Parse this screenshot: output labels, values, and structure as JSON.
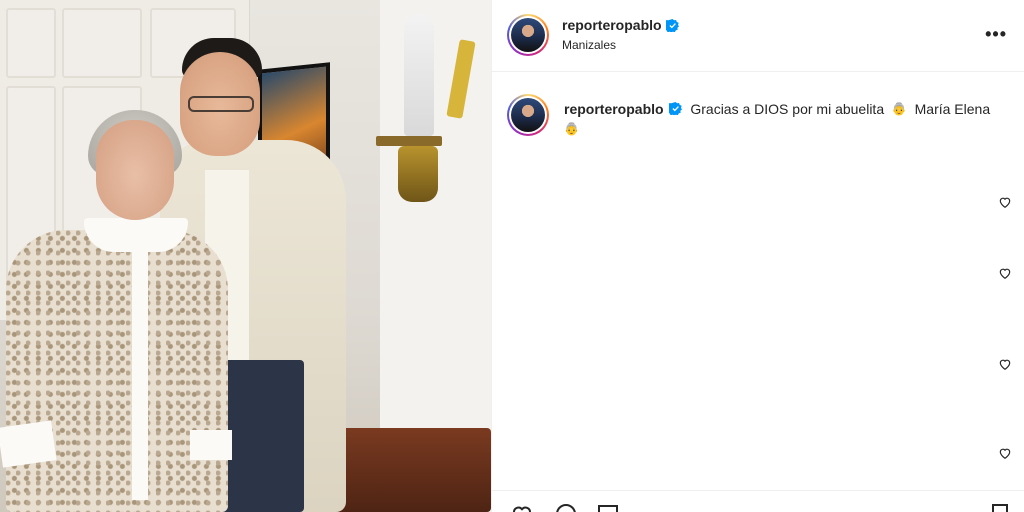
{
  "post": {
    "author": {
      "username": "reporteropablo",
      "location": "Manizales",
      "verified": true
    },
    "caption": {
      "username": "reporteropablo",
      "text_part1": "Gracias a DIOS por mi abuelita",
      "emoji1": "👵",
      "text_part2": "María Elena",
      "emoji2": "👵"
    },
    "comments_like_icons": 4,
    "more_menu": "•••"
  },
  "colors": {
    "verified": "#0095f6",
    "text": "#262626",
    "border": "#efefef"
  },
  "icons": [
    "verified-badge-icon",
    "more-options-icon",
    "heart-icon",
    "like-icon",
    "comment-icon",
    "share-icon",
    "save-icon"
  ]
}
